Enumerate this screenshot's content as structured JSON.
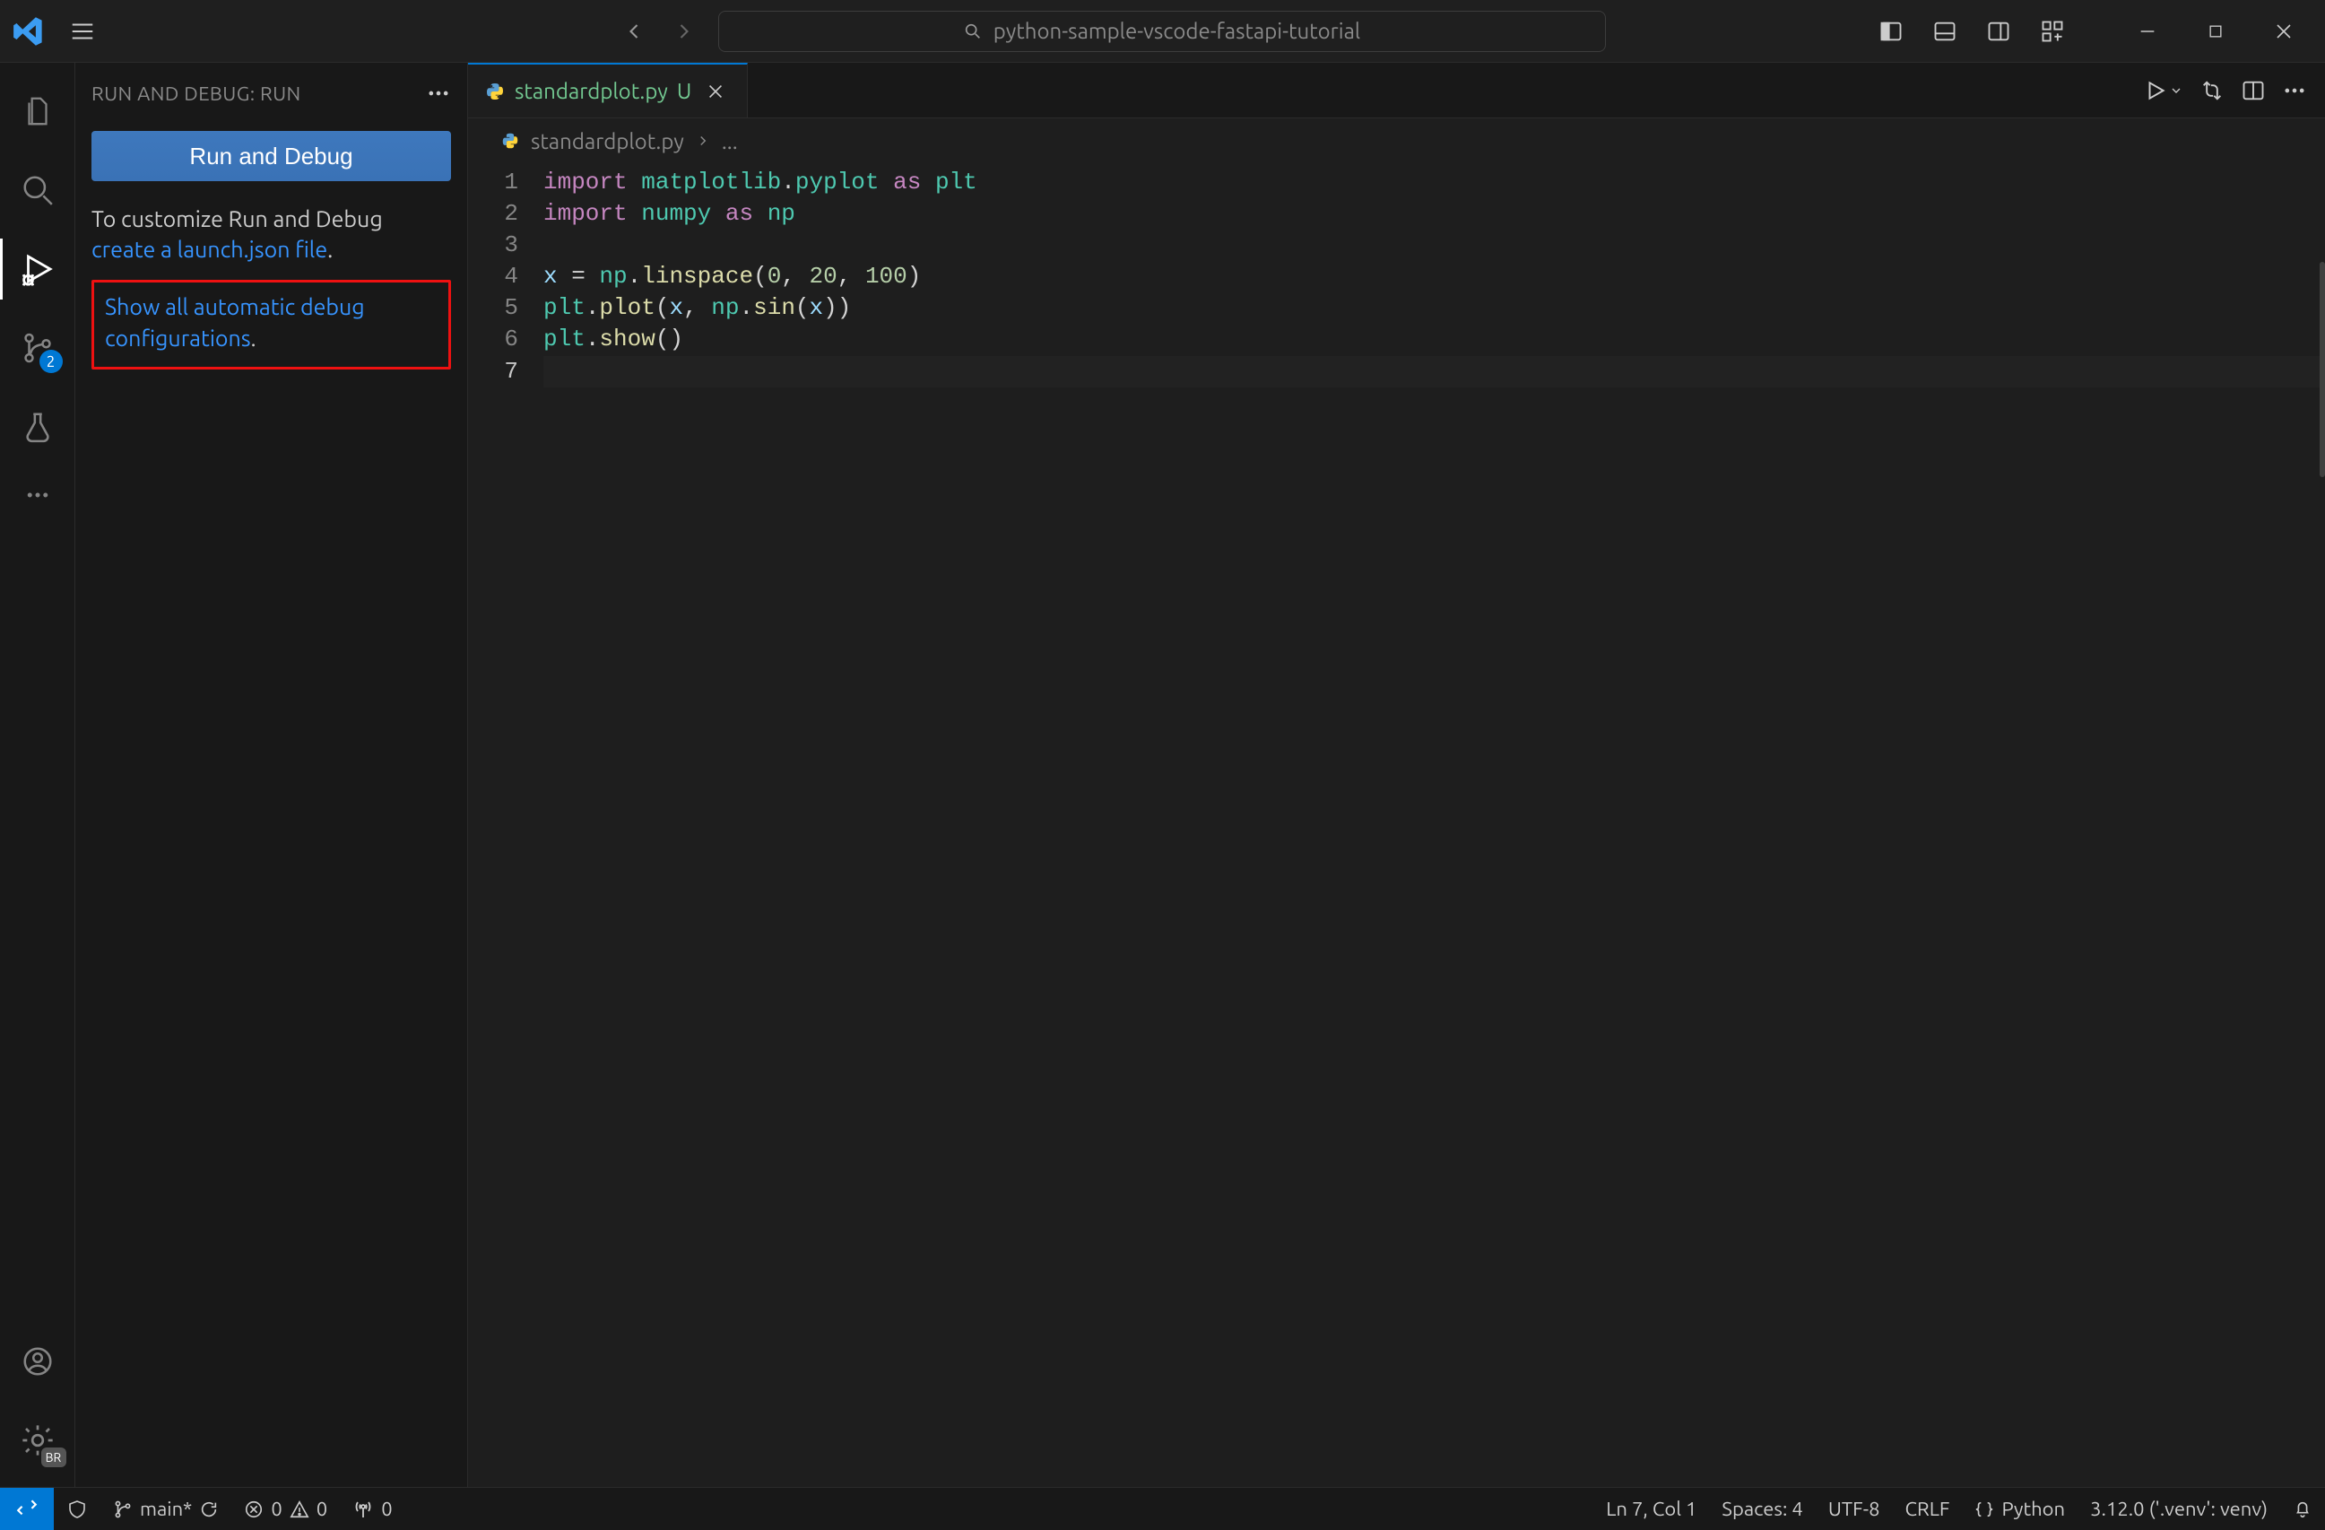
{
  "titlebar": {
    "command_center": "python-sample-vscode-fastapi-tutorial"
  },
  "activitybar": {
    "badge_scm": "2",
    "badge_settings": "BR"
  },
  "sidebar": {
    "title": "RUN AND DEBUG: RUN",
    "run_button": "Run and Debug",
    "customize_text": "To customize Run and Debug ",
    "create_link": "create a launch.json file",
    "dot": ".",
    "show_all_link": "Show all automatic debug configurations",
    "dot2": "."
  },
  "editor": {
    "tab": {
      "filename": "standardplot.py",
      "modified_marker": "U"
    },
    "breadcrumb": {
      "file": "standardplot.py",
      "more": "..."
    },
    "run_dropdown_tooltip": "Run",
    "gutter": [
      "1",
      "2",
      "3",
      "4",
      "5",
      "6",
      "7"
    ]
  },
  "code": {
    "l1": {
      "p": [
        [
          "kw",
          "import"
        ],
        [
          "op",
          " "
        ],
        [
          "mod",
          "matplotlib"
        ],
        [
          "op",
          "."
        ],
        [
          "mod",
          "pyplot"
        ],
        [
          "op",
          " "
        ],
        [
          "kw",
          "as"
        ],
        [
          "op",
          " "
        ],
        [
          "mod",
          "plt"
        ]
      ]
    },
    "l2": {
      "p": [
        [
          "kw",
          "import"
        ],
        [
          "op",
          " "
        ],
        [
          "mod",
          "numpy"
        ],
        [
          "op",
          " "
        ],
        [
          "kw",
          "as"
        ],
        [
          "op",
          " "
        ],
        [
          "mod",
          "np"
        ]
      ]
    },
    "l3": {
      "p": [
        [
          "op",
          ""
        ]
      ]
    },
    "l4": {
      "p": [
        [
          "var",
          "x"
        ],
        [
          "op",
          " = "
        ],
        [
          "mod",
          "np"
        ],
        [
          "op",
          "."
        ],
        [
          "fn",
          "linspace"
        ],
        [
          "op",
          "("
        ],
        [
          "num",
          "0"
        ],
        [
          "op",
          ", "
        ],
        [
          "num",
          "20"
        ],
        [
          "op",
          ", "
        ],
        [
          "num",
          "100"
        ],
        [
          "op",
          ")"
        ]
      ]
    },
    "l5": {
      "p": [
        [
          "mod",
          "plt"
        ],
        [
          "op",
          "."
        ],
        [
          "fn",
          "plot"
        ],
        [
          "op",
          "("
        ],
        [
          "var",
          "x"
        ],
        [
          "op",
          ", "
        ],
        [
          "mod",
          "np"
        ],
        [
          "op",
          "."
        ],
        [
          "fn",
          "sin"
        ],
        [
          "op",
          "("
        ],
        [
          "var",
          "x"
        ],
        [
          "op",
          "))"
        ]
      ]
    },
    "l6": {
      "p": [
        [
          "mod",
          "plt"
        ],
        [
          "op",
          "."
        ],
        [
          "fn",
          "show"
        ],
        [
          "op",
          "()"
        ]
      ]
    },
    "l7": {
      "p": [
        [
          "op",
          ""
        ]
      ]
    }
  },
  "statusbar": {
    "branch": "main*",
    "errors": "0",
    "warnings": "0",
    "ports": "0",
    "position": "Ln 7, Col 1",
    "spaces": "Spaces: 4",
    "encoding": "UTF-8",
    "eol": "CRLF",
    "lang": "Python",
    "interpreter": "3.12.0 ('.venv': venv)"
  }
}
